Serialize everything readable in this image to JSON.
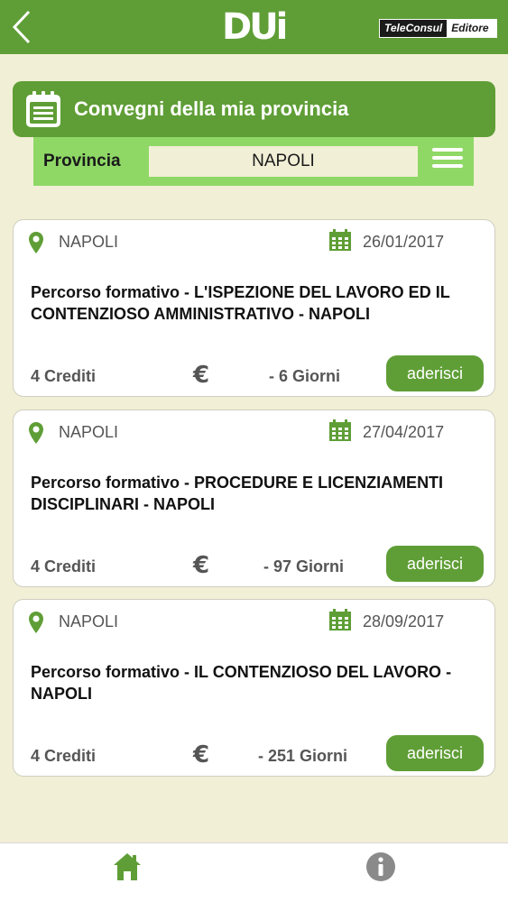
{
  "header": {
    "logo_text": "DUi",
    "brand_part1": "TeleConsul",
    "brand_part2": "Editore"
  },
  "section": {
    "title": "Convegni della mia provincia"
  },
  "filter": {
    "label": "Provincia",
    "selected_value": "NAPOLI"
  },
  "events": [
    {
      "city": "NAPOLI",
      "date": "26/01/2017",
      "title": "Percorso formativo -  L'ISPEZIONE DEL LAVORO ED IL CONTENZIOSO AMMINISTRATIVO - NAPOLI",
      "credits": "4 Crediti",
      "currency_symbol": "€",
      "days": "- 6 Giorni",
      "button_label": "aderisci"
    },
    {
      "city": "NAPOLI",
      "date": "27/04/2017",
      "title": "Percorso formativo -  PROCEDURE E LICENZIAMENTI DISCIPLINARI - NAPOLI",
      "credits": "4 Crediti",
      "currency_symbol": "€",
      "days": "- 97 Giorni",
      "button_label": "aderisci"
    },
    {
      "city": "NAPOLI",
      "date": "28/09/2017",
      "title": "Percorso formativo - IL CONTENZIOSO DEL LAVORO - NAPOLI",
      "credits": "4 Crediti",
      "currency_symbol": "€",
      "days": "- 251 Giorni",
      "button_label": "aderisci"
    }
  ],
  "tabbar": {
    "items": [
      "home-icon",
      "info-icon"
    ]
  },
  "colors": {
    "primary_green": "#5f9e36",
    "light_green": "#8fd866",
    "background": "#f1efd6"
  }
}
